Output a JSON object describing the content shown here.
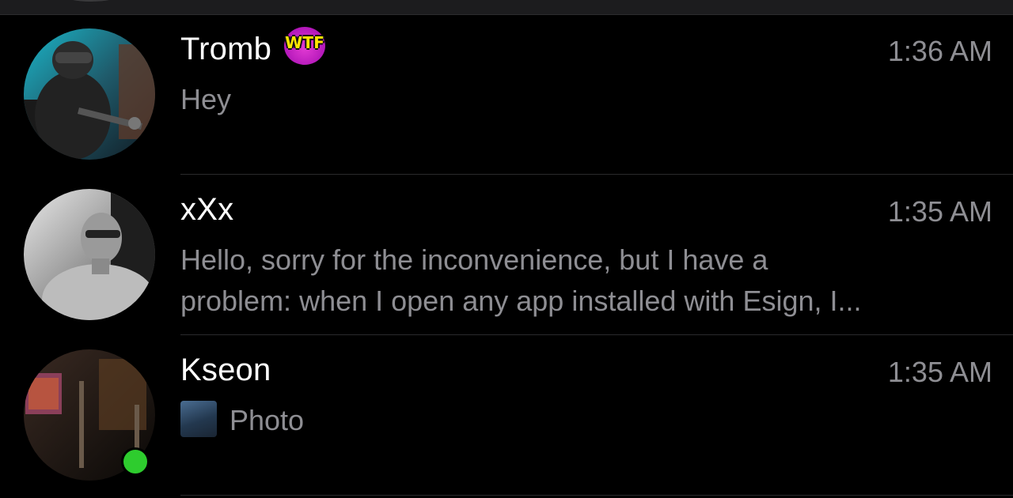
{
  "chats": [
    {
      "name": "Tromb",
      "badge": "WTF",
      "time": "1:36 AM",
      "preview": "Hey"
    },
    {
      "name": "xXx",
      "time": "1:35 AM",
      "preview_line1": "Hello, sorry for the inconvenience, but I have a",
      "preview_line2": "problem: when I open any app installed with Esign, I..."
    },
    {
      "name": "Kseon",
      "time": "1:35 AM",
      "preview": "Photo",
      "online": true,
      "online_color": "#2ecc2e"
    }
  ],
  "colors": {
    "background": "#000000",
    "name_text": "#ffffff",
    "secondary_text": "#8e8e93",
    "separator": "#2a2a2c",
    "badge_bg": "#c11fc4",
    "badge_text": "#ffe600"
  }
}
